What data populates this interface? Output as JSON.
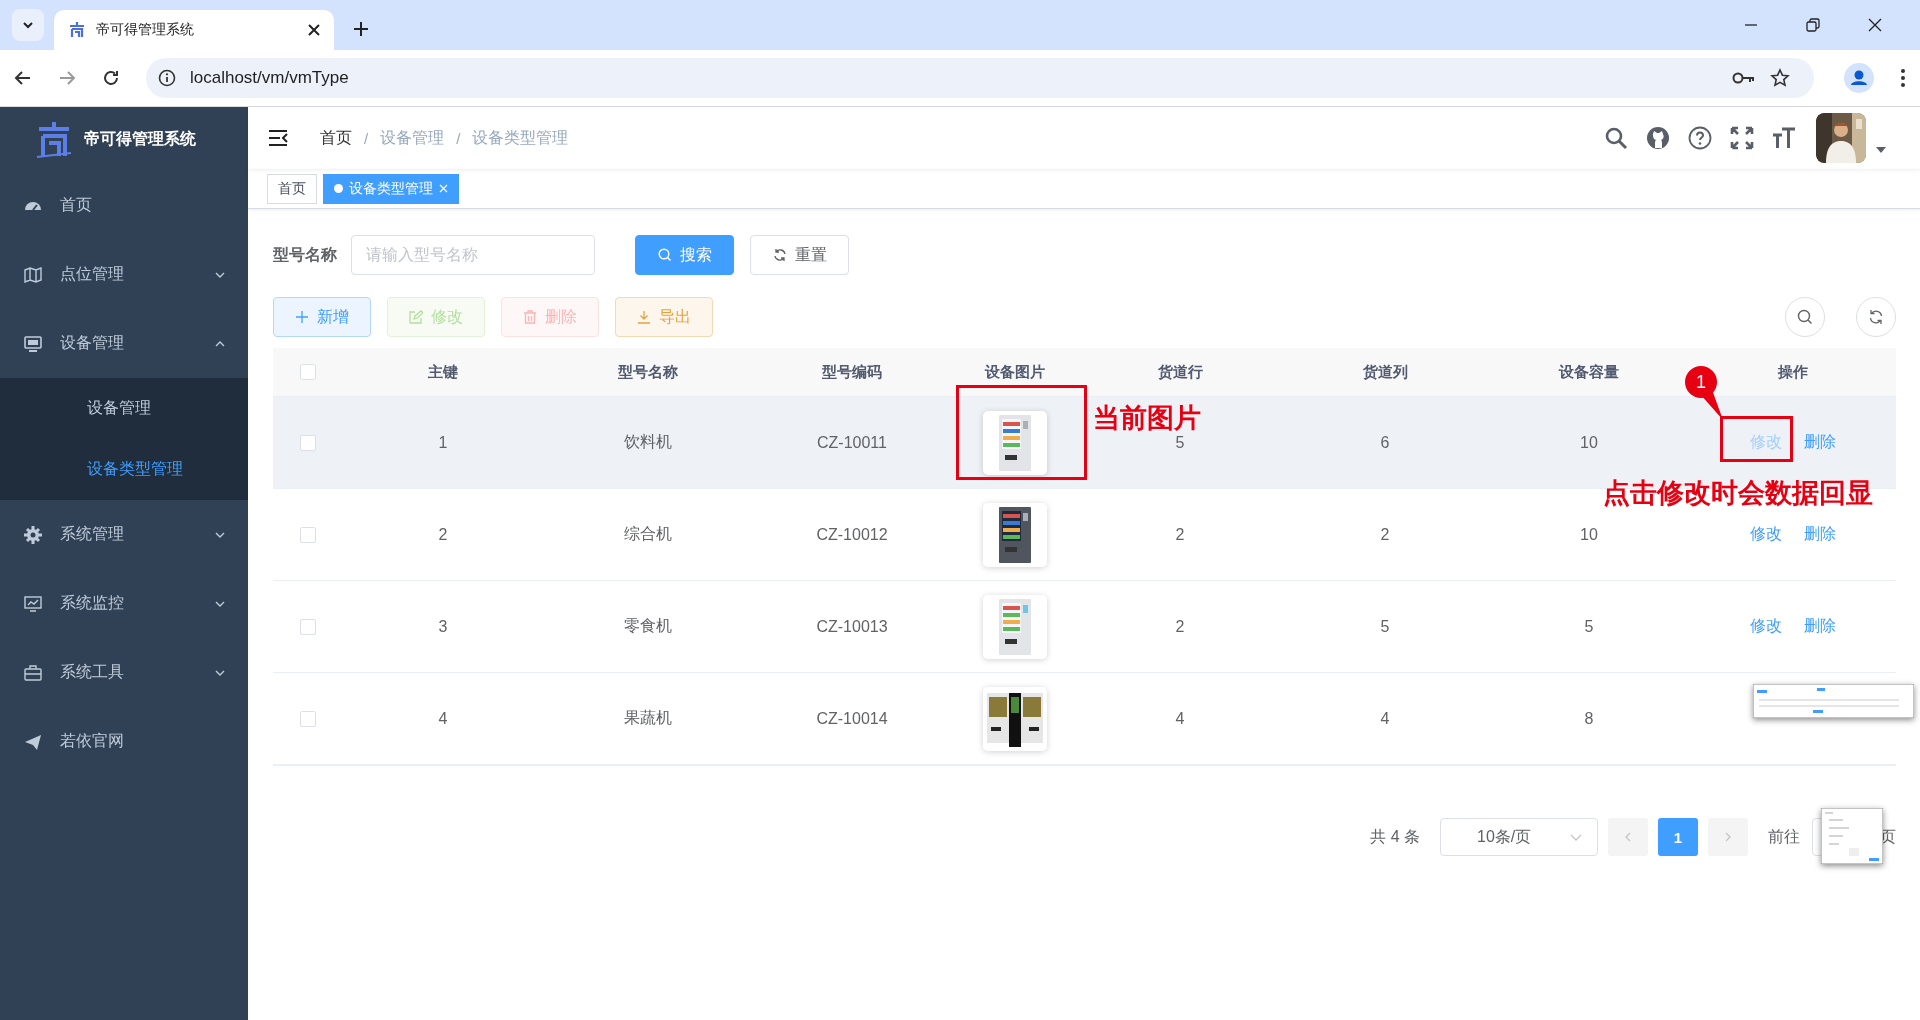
{
  "browser": {
    "tab_title": "帝可得管理系统",
    "url": "localhost/vm/vmType"
  },
  "sidebar": {
    "title": "帝可得管理系统",
    "items": [
      {
        "label": "首页",
        "kind": "link"
      },
      {
        "label": "点位管理",
        "kind": "menu",
        "expanded": false
      },
      {
        "label": "设备管理",
        "kind": "menu",
        "expanded": true,
        "children": [
          {
            "label": "设备管理",
            "selected": false
          },
          {
            "label": "设备类型管理",
            "selected": true
          }
        ]
      },
      {
        "label": "系统管理",
        "kind": "menu",
        "expanded": false
      },
      {
        "label": "系统监控",
        "kind": "menu",
        "expanded": false
      },
      {
        "label": "系统工具",
        "kind": "menu",
        "expanded": false
      },
      {
        "label": "若依官网",
        "kind": "link"
      }
    ]
  },
  "breadcrumb": {
    "separator": "/",
    "items": [
      {
        "label": "首页",
        "kind": "link"
      },
      {
        "label": "设备管理",
        "kind": "text"
      },
      {
        "label": "设备类型管理",
        "kind": "text"
      }
    ]
  },
  "tags": [
    {
      "label": "首页",
      "selected": false
    },
    {
      "label": "设备类型管理",
      "selected": true
    }
  ],
  "search": {
    "label": "型号名称",
    "placeholder": "请输入型号名称",
    "buttons": [
      {
        "label": "搜索",
        "kind": "primary"
      },
      {
        "label": "重置",
        "kind": "default"
      }
    ]
  },
  "toolbar": [
    {
      "label": "新增",
      "kind": "primary",
      "disabled": false
    },
    {
      "label": "修改",
      "kind": "success",
      "disabled": true
    },
    {
      "label": "删除",
      "kind": "danger",
      "disabled": true
    },
    {
      "label": "导出",
      "kind": "warning",
      "disabled": false
    }
  ],
  "table": {
    "columns": [
      "主键",
      "型号名称",
      "型号编码",
      "设备图片",
      "货道行",
      "货道列",
      "设备容量",
      "操作"
    ],
    "header_checked": false,
    "rows": [
      {
        "checked": false,
        "hovered": true,
        "cells": [
          "1",
          "饮料机",
          "CZ-10011",
          "",
          "5",
          "6",
          "10"
        ],
        "actions": [
          {
            "label": "修改",
            "faded": true
          },
          {
            "label": "删除",
            "faded": false
          }
        ]
      },
      {
        "checked": false,
        "hovered": false,
        "cells": [
          "2",
          "综合机",
          "CZ-10012",
          "",
          "2",
          "2",
          "10"
        ],
        "actions": [
          {
            "label": "修改",
            "faded": false
          },
          {
            "label": "删除",
            "faded": false
          }
        ]
      },
      {
        "checked": false,
        "hovered": false,
        "cells": [
          "3",
          "零食机",
          "CZ-10013",
          "",
          "2",
          "5",
          "5"
        ],
        "actions": [
          {
            "label": "修改",
            "faded": false
          },
          {
            "label": "删除",
            "faded": false
          }
        ]
      },
      {
        "checked": false,
        "hovered": false,
        "cells": [
          "4",
          "果蔬机",
          "CZ-10014",
          "",
          "4",
          "4",
          "8"
        ],
        "actions": []
      }
    ]
  },
  "annotations": {
    "image_note": "当前图片",
    "badge": "1",
    "edit_note": "点击修改时会数据回显"
  },
  "pagination": {
    "total": "共 4 条",
    "page_size": "10条/页",
    "pages": [
      {
        "label": "1",
        "selected": true
      }
    ],
    "goto": "前往",
    "suffix": "页"
  }
}
